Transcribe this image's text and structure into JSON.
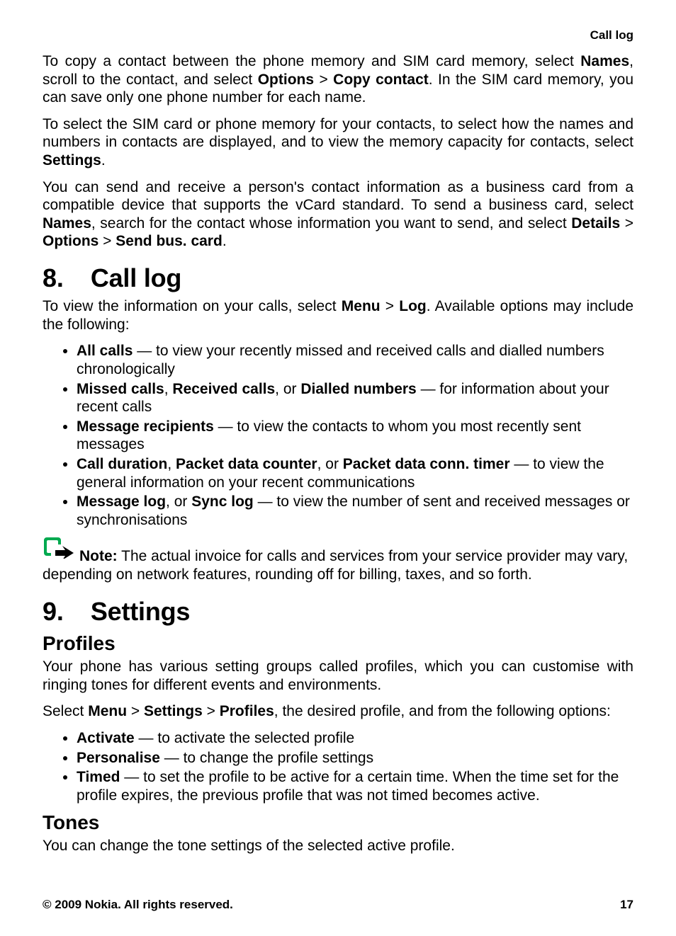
{
  "header": {
    "section": "Call log"
  },
  "intro": {
    "p1": {
      "t1": "To copy a contact between the phone memory and SIM card memory, select ",
      "b1": "Names",
      "t2": ", scroll to the contact, and select ",
      "b2": "Options",
      "gt1": " > ",
      "b3": "Copy contact",
      "t3": ". In the SIM card memory, you can save only one phone number for each name."
    },
    "p2": {
      "t1": "To select the SIM card or phone memory for your contacts, to select how the names and numbers in contacts are displayed, and to view the memory capacity for contacts, select ",
      "b1": "Settings",
      "t2": "."
    },
    "p3": {
      "t1": "You can send and receive a person's contact information as a business card from a compatible device that supports the vCard standard. To send a business card, select ",
      "b1": "Names",
      "t2": ", search for the contact whose information you want to send, and select ",
      "b2": "Details",
      "gt1": " > ",
      "b3": "Options",
      "gt2": " > ",
      "b4": "Send bus. card",
      "t3": "."
    }
  },
  "s8": {
    "num": "8.",
    "title": "Call log",
    "lead": {
      "t1": "To view the information on your calls, select ",
      "b1": "Menu",
      "gt1": " > ",
      "b2": "Log",
      "t2": ". Available options may include the following:"
    },
    "items": [
      {
        "b1": "All calls",
        "rest": " — to view your recently missed and received calls and dialled numbers chronologically"
      },
      {
        "b1": "Missed calls",
        "t1": ", ",
        "b2": "Received calls",
        "t2": ", or ",
        "b3": "Dialled numbers",
        "rest": " — for information about your recent calls"
      },
      {
        "b1": "Message recipients",
        "rest": " — to view the contacts to whom you most recently sent messages"
      },
      {
        "b1": "Call duration",
        "t1": ", ",
        "b2": "Packet data counter",
        "t2": ", or ",
        "b3": "Packet data conn. timer",
        "rest": " — to view the general information on your recent communications"
      },
      {
        "b1": "Message log",
        "t1": ", or ",
        "b2": "Sync log",
        "rest": " — to view the number of sent and received messages or synchronisations"
      }
    ],
    "note": {
      "label": "Note:",
      "text": "  The actual invoice for calls and services from your service provider may vary, depending on network features, rounding off for billing, taxes, and so forth."
    }
  },
  "s9": {
    "num": "9.",
    "title": "Settings",
    "profiles": {
      "heading": "Profiles",
      "p1": "Your phone has various setting groups called profiles, which you can customise with ringing tones for different events and environments.",
      "p2": {
        "t1": "Select ",
        "b1": "Menu",
        "gt1": " > ",
        "b2": "Settings",
        "gt2": " > ",
        "b3": "Profiles",
        "t2": ", the desired profile, and from the following options:"
      },
      "items": [
        {
          "b1": "Activate",
          "rest": "  — to activate the selected profile"
        },
        {
          "b1": "Personalise",
          "rest": "  — to change the profile settings"
        },
        {
          "b1": "Timed",
          "rest": "  — to set the profile to be active for a certain time. When the time set for the profile expires, the previous profile that was not timed becomes active."
        }
      ]
    },
    "tones": {
      "heading": "Tones",
      "p1": "You can change the tone settings of the selected active profile."
    }
  },
  "footer": {
    "copyright": "© 2009 Nokia. All rights reserved.",
    "page": "17"
  }
}
